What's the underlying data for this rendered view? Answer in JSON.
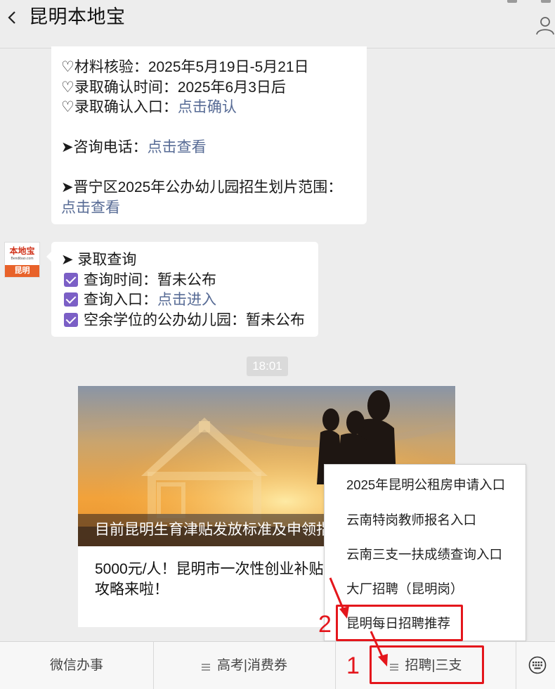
{
  "header": {
    "title": "昆明本地宝"
  },
  "message1": {
    "lines": [
      {
        "text": "♡材料核验：2025年5月19日-5月21日",
        "link": ""
      },
      {
        "text": "♡录取确认时间：2025年6月3日后",
        "link": ""
      },
      {
        "text": "♡录取确认入口：",
        "link": "点击确认"
      },
      {
        "text": "",
        "link": ""
      },
      {
        "text": "➤咨询电话：",
        "link": "点击查看"
      },
      {
        "text": "",
        "link": ""
      },
      {
        "text": "➤晋宁区2025年公办幼儿园招生划片范围：",
        "link": ""
      },
      {
        "text": "",
        "link": "点击查看"
      }
    ]
  },
  "avatar": {
    "brand": "本地宝",
    "url": "Bendibao.com",
    "city": "昆明"
  },
  "message2": {
    "heading": "➤ 录取查询",
    "items": [
      {
        "text": "查询时间：暂未公布",
        "link": ""
      },
      {
        "text": "查询入口：",
        "link": "点击进入"
      },
      {
        "text": "空余学位的公办幼儿园：暂未公布",
        "link": ""
      }
    ]
  },
  "timestamp": "18:01",
  "article_card": {
    "caption": "目前昆明生育津贴发放标准及申领指南",
    "desc": "5000元/人！昆明市一次性创业补贴攻略来啦！"
  },
  "menu": {
    "items": [
      "2025年昆明公租房申请入口",
      "云南特岗教师报名入口",
      "云南三支一扶成绩查询入口",
      "大厂招聘（昆明岗）",
      "昆明每日招聘推荐"
    ]
  },
  "tabbar": {
    "tab1": "微信办事",
    "tab2": "高考|消费券",
    "tab3": "招聘|三支"
  },
  "annotations": {
    "num1": "1",
    "num2": "2",
    "color": "#e4161c"
  },
  "colors": {
    "link": "#576b95",
    "checkbox": "#7b5fc6",
    "background": "#ededed"
  }
}
